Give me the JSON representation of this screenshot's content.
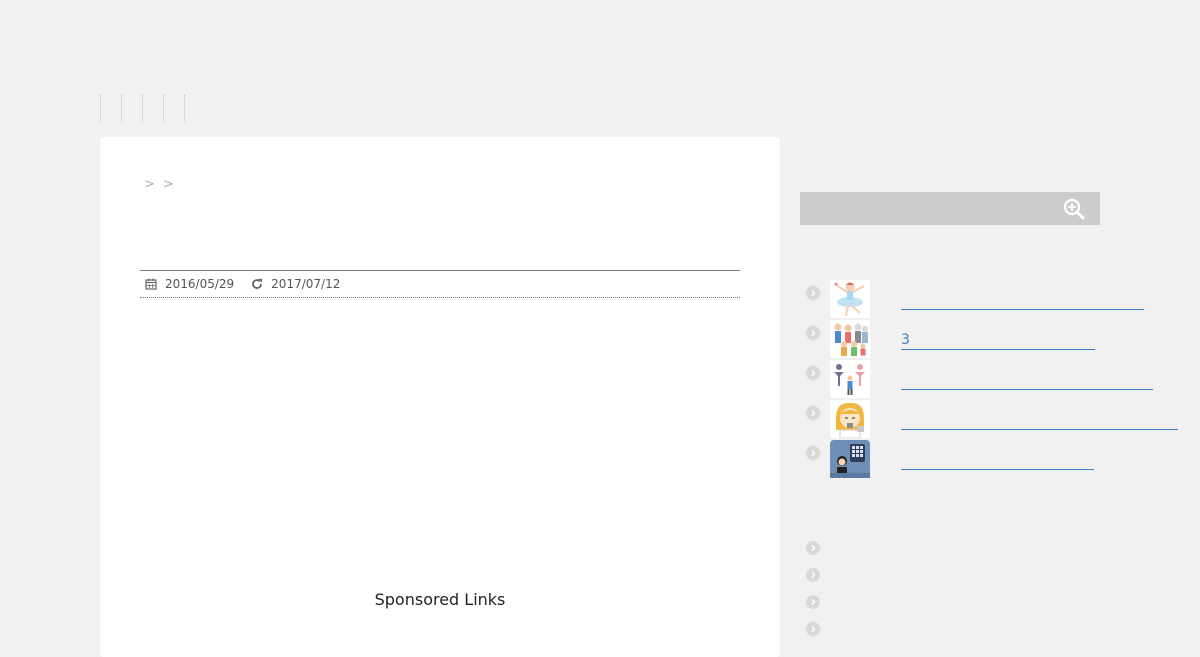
{
  "nav": {
    "items": [
      "",
      "",
      "",
      ""
    ]
  },
  "breadcrumb": {
    "separators": [
      ">",
      ">"
    ]
  },
  "post": {
    "published": "2016/05/29",
    "updated": "2017/07/12",
    "calendar_icon": "calendar-icon",
    "refresh_icon": "refresh-icon"
  },
  "sponsored": {
    "label": "Sponsored Links"
  },
  "search": {
    "placeholder": "",
    "icon": "zoom-in-icon"
  },
  "popular": {
    "items": [
      {
        "label": "",
        "thumb": "ballerina-icon"
      },
      {
        "label": "3",
        "thumb": "family-icon"
      },
      {
        "label": "",
        "thumb": "figures-icon"
      },
      {
        "label": "",
        "thumb": "girl-phone-icon"
      },
      {
        "label": "",
        "thumb": "payphone-icon"
      }
    ]
  },
  "recent": {
    "items": [
      "",
      "",
      "",
      ""
    ]
  },
  "colors": {
    "link": "#3b7dc4",
    "background": "#f1f1f1",
    "search_bg": "#cccccc"
  }
}
